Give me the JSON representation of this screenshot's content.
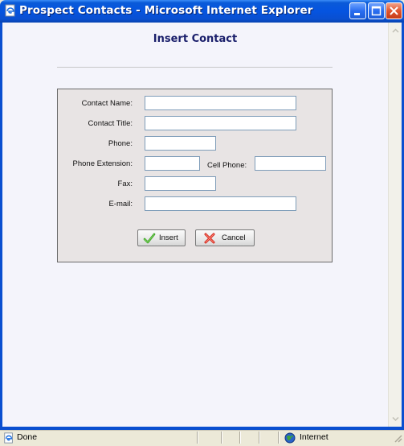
{
  "window": {
    "title": "Prospect Contacts - Microsoft Internet Explorer",
    "icon": "ie-page-icon",
    "controls": [
      "minimize-icon",
      "maximize-icon",
      "close-icon"
    ]
  },
  "page": {
    "heading": "Insert Contact"
  },
  "form": {
    "contact_name": {
      "label": "Contact Name:",
      "value": ""
    },
    "contact_title": {
      "label": "Contact Title:",
      "value": ""
    },
    "phone": {
      "label": "Phone:",
      "value": ""
    },
    "phone_extension": {
      "label": "Phone Extension:",
      "value": ""
    },
    "cell_phone": {
      "label": "Cell Phone:",
      "value": ""
    },
    "fax": {
      "label": "Fax:",
      "value": ""
    },
    "email": {
      "label": "E-mail:",
      "value": ""
    }
  },
  "buttons": {
    "insert": {
      "label": "Insert",
      "icon": "check-icon"
    },
    "cancel": {
      "label": "Cancel",
      "icon": "cancel-x-icon"
    }
  },
  "statusbar": {
    "status": "Done",
    "zone": "Internet",
    "icons": [
      "ie-page-icon",
      "globe-icon"
    ]
  },
  "colors": {
    "titlebar": "#0554e0",
    "heading": "#1a1f6b",
    "panel": "#e8e4e4",
    "content_bg": "#f4f4fb"
  }
}
